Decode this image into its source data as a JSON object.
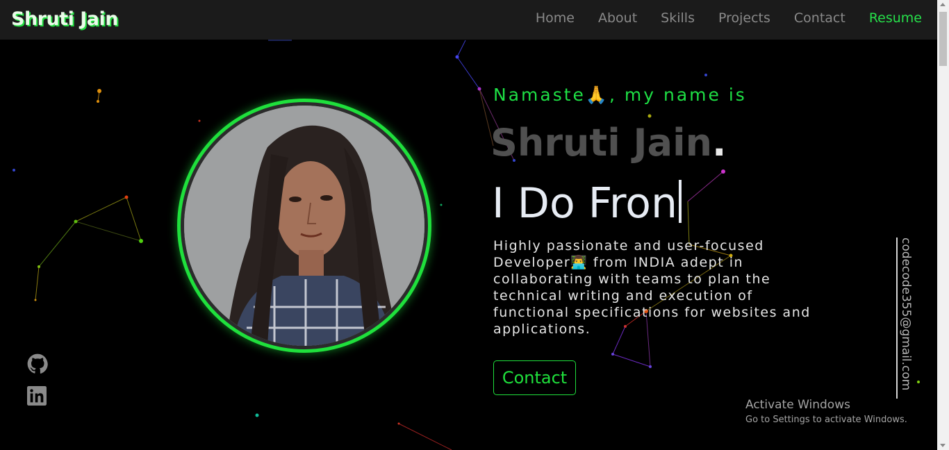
{
  "nav": {
    "brand": "Shruti Jain",
    "links": [
      "Home",
      "About",
      "Skills",
      "Projects",
      "Contact"
    ],
    "resume": "Resume"
  },
  "hero": {
    "greeting": "Namaste🙏, my name is",
    "name": "Shruti Jain",
    "name_dot": ".",
    "typed_text": "I Do Fron",
    "bio": "Highly passionate and user-focused Developer👨‍💻 from INDIA adept in collaborating with teams to plan the technical writing and execution of functional specifications for websites and applications.",
    "contact_button": "Contact"
  },
  "social": {
    "github_icon": "github-icon",
    "linkedin_icon": "linkedin-icon"
  },
  "email": "codecode355@gmail.com",
  "watermark": {
    "title": "Activate Windows",
    "subtitle": "Go to Settings to activate Windows."
  },
  "colors": {
    "accent": "#1fe03c",
    "background": "#000000",
    "navbar": "#1b1b1b",
    "muted_name": "#505050"
  }
}
